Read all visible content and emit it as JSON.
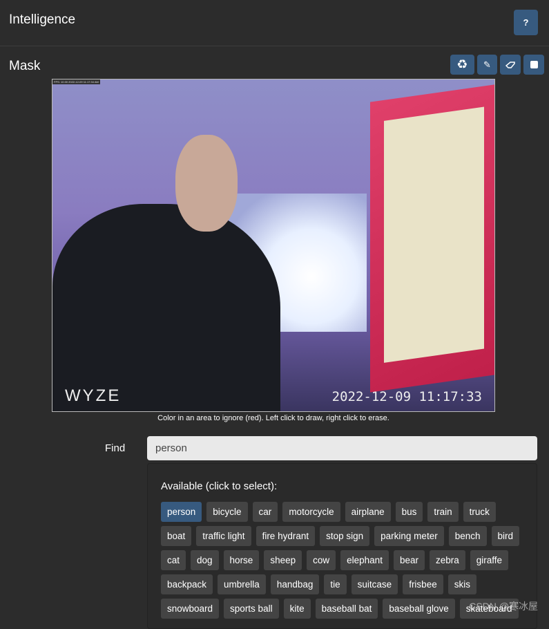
{
  "header": {
    "title": "Intelligence",
    "help_label": "?"
  },
  "mask": {
    "title": "Mask",
    "tools": [
      {
        "icon": "recycle-icon"
      },
      {
        "icon": "pencil-icon"
      },
      {
        "icon": "eraser-icon"
      },
      {
        "icon": "square-icon"
      }
    ],
    "camera": {
      "overlay_tag": "FPS: 10.00 2022-12-09 11:17:34 AM",
      "logo": "WYZE",
      "timestamp": "2022-12-09 11:17:33"
    },
    "hint": "Color in an area to ignore (red). Left click to draw, right click to erase."
  },
  "find": {
    "label": "Find",
    "value": "person"
  },
  "available": {
    "label": "Available (click to select):",
    "selected": "person",
    "items": [
      "person",
      "bicycle",
      "car",
      "motorcycle",
      "airplane",
      "bus",
      "train",
      "truck",
      "boat",
      "traffic light",
      "fire hydrant",
      "stop sign",
      "parking meter",
      "bench",
      "bird",
      "cat",
      "dog",
      "horse",
      "sheep",
      "cow",
      "elephant",
      "bear",
      "zebra",
      "giraffe",
      "backpack",
      "umbrella",
      "handbag",
      "tie",
      "suitcase",
      "frisbee",
      "skis",
      "snowboard",
      "sports ball",
      "kite",
      "baseball bat",
      "baseball glove",
      "skateboard"
    ]
  },
  "watermark": "CSDN @寒冰屋",
  "colors": {
    "accent": "#375a7f",
    "chip": "#444444",
    "background": "#2c2c2c"
  }
}
